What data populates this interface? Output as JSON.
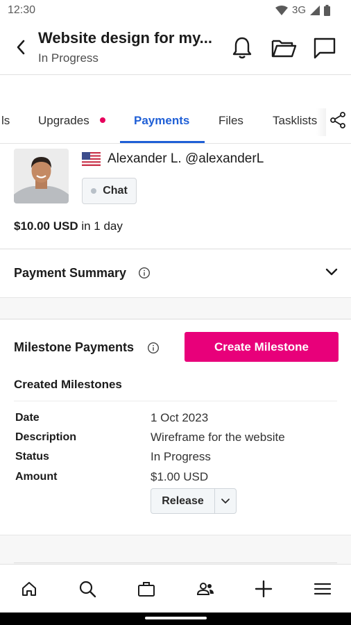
{
  "status_bar": {
    "time": "12:30",
    "network": "3G"
  },
  "app_bar": {
    "title": "Website design for my...",
    "subtitle": "In Progress",
    "icons": [
      "back-icon",
      "bell-icon",
      "folder-icon",
      "chat-bubble-icon"
    ]
  },
  "tabs": {
    "items": [
      {
        "label": "ls"
      },
      {
        "label": "Upgrades",
        "has_dot": true
      },
      {
        "label": "Payments",
        "active": true
      },
      {
        "label": "Files"
      },
      {
        "label": "Tasklists"
      }
    ],
    "share_icon": "share-icon",
    "accent": "#1f5fd6",
    "dot_color": "#e6005c"
  },
  "profile": {
    "name": "Alexander L. @alexanderL",
    "chat_label": "Chat",
    "price_amount": "$10.00 USD",
    "price_suffix": " in 1 day"
  },
  "payment_summary": {
    "title": "Payment Summary"
  },
  "milestones": {
    "title": "Milestone Payments",
    "create_button": "Create Milestone",
    "create_button_color": "#e8007a",
    "created_title": "Created Milestones",
    "rows": [
      {
        "label": "Date",
        "value": "1 Oct 2023"
      },
      {
        "label": "Description",
        "value": "Wireframe for the website"
      },
      {
        "label": "Status",
        "value": "In Progress"
      },
      {
        "label": "Amount",
        "value": "$1.00 USD"
      }
    ],
    "release_label": "Release"
  },
  "bottom_nav": {
    "items": [
      "home-icon",
      "search-icon",
      "briefcase-icon",
      "people-icon",
      "plus-icon",
      "menu-icon"
    ]
  }
}
